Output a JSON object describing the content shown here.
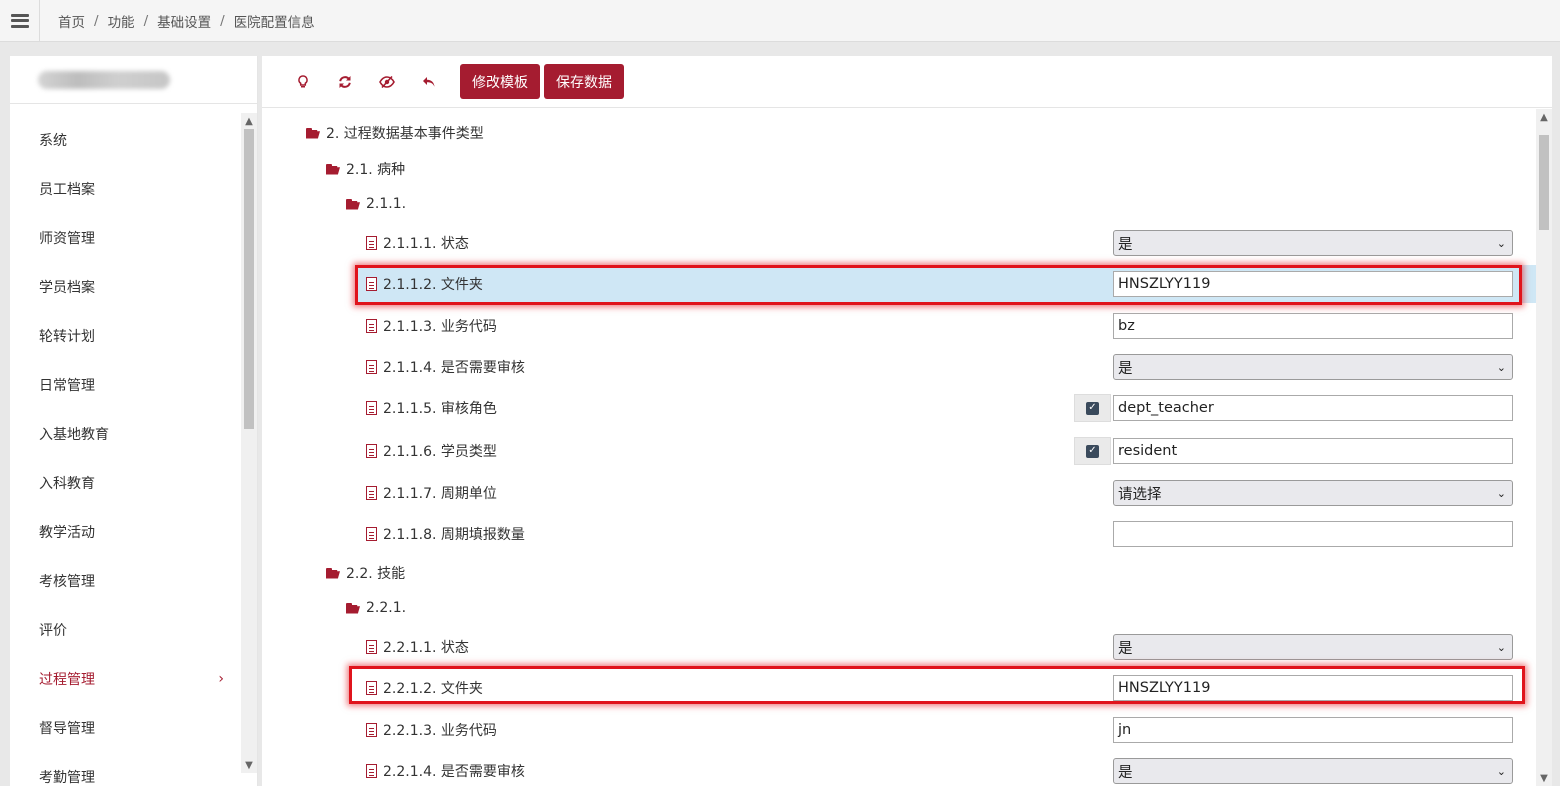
{
  "breadcrumb": [
    "首页",
    "功能",
    "基础设置",
    "医院配置信息"
  ],
  "sidebar": {
    "items": [
      {
        "label": "系统"
      },
      {
        "label": "员工档案"
      },
      {
        "label": "师资管理"
      },
      {
        "label": "学员档案"
      },
      {
        "label": "轮转计划"
      },
      {
        "label": "日常管理"
      },
      {
        "label": "入基地教育"
      },
      {
        "label": "入科教育"
      },
      {
        "label": "教学活动"
      },
      {
        "label": "考核管理"
      },
      {
        "label": "评价"
      },
      {
        "label": "过程管理",
        "active": true
      },
      {
        "label": "督导管理"
      },
      {
        "label": "考勤管理"
      }
    ],
    "active_chevron": "›"
  },
  "toolbar": {
    "icons": [
      "lightbulb-icon",
      "refresh-icon",
      "eye-slash-icon",
      "undo-icon"
    ],
    "edit_template": "修改模板",
    "save_data": "保存数据"
  },
  "tree": {
    "n2": "2. 过程数据基本事件类型",
    "n21": "2.1. 病种",
    "n211": "2.1.1.",
    "n22": "2.2. 技能",
    "n221": "2.2.1.",
    "rows_211": [
      {
        "label": "2.1.1.1. 状态",
        "type": "select",
        "value": "是"
      },
      {
        "label": "2.1.1.2. 文件夹",
        "type": "text",
        "value": "HNSZLYY119"
      },
      {
        "label": "2.1.1.3. 业务代码",
        "type": "text",
        "value": "bz"
      },
      {
        "label": "2.1.1.4. 是否需要审核",
        "type": "select",
        "value": "是"
      },
      {
        "label": "2.1.1.5. 审核角色",
        "type": "text",
        "value": "dept_teacher"
      },
      {
        "label": "2.1.1.6. 学员类型",
        "type": "text",
        "value": "resident"
      },
      {
        "label": "2.1.1.7. 周期单位",
        "type": "select",
        "value": "请选择"
      },
      {
        "label": "2.1.1.8. 周期填报数量",
        "type": "text",
        "value": ""
      }
    ],
    "rows_221": [
      {
        "label": "2.2.1.1. 状态",
        "type": "select",
        "value": "是"
      },
      {
        "label": "2.2.1.2. 文件夹",
        "type": "text",
        "value": "HNSZLYY119"
      },
      {
        "label": "2.2.1.3. 业务代码",
        "type": "text",
        "value": "jn"
      },
      {
        "label": "2.2.1.4. 是否需要审核",
        "type": "select",
        "value": "是"
      }
    ]
  },
  "colors": {
    "accent": "#a51c30",
    "highlight_row": "#cfe7f5",
    "annotation_red": "#e0141c"
  }
}
